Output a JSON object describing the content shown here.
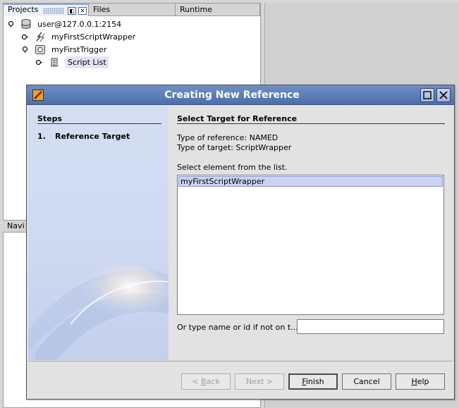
{
  "ide": {
    "tabs": {
      "projects": "Projects",
      "files": "Files",
      "runtime": "Runtime"
    },
    "tree": {
      "server": "user@127.0.0.1:2154",
      "wrapper": "myFirstScriptWrapper",
      "trigger": "myFirstTrigger",
      "script_list": "Script List"
    },
    "navigator_tab": "Navi"
  },
  "dialog": {
    "title": "Creating New Reference",
    "steps": {
      "title": "Steps",
      "items": [
        {
          "number": "1.",
          "label": "Reference Target"
        }
      ]
    },
    "content": {
      "title": "Select Target for Reference",
      "reference_type": "Type of reference: NAMED",
      "target_type": "Type of target: ScriptWrapper",
      "list_prompt": "Select element from the list.",
      "list_items": [
        "myFirstScriptWrapper"
      ],
      "selected_index": 0,
      "name_label": "Or type name or id if not on t...",
      "name_value": ""
    },
    "buttons": {
      "back": {
        "prefix": "< ",
        "mnemonic": "B",
        "rest": "ack"
      },
      "next": "Next >",
      "finish": {
        "mnemonic": "F",
        "rest": "inish"
      },
      "cancel": "Cancel",
      "help": {
        "mnemonic": "H",
        "rest": "elp"
      }
    }
  },
  "colors": {
    "titlebar": "#5a7bb5",
    "steps_panel": "#cfd9f1",
    "selection": "#ccd2f4"
  }
}
